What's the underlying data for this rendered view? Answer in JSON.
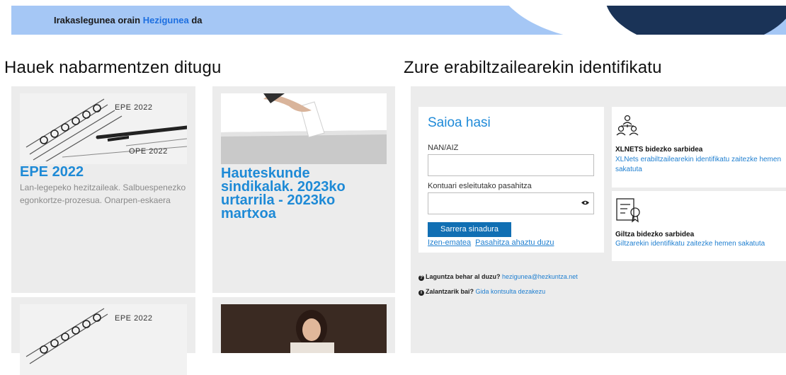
{
  "banner": {
    "prefix": "Irakaslegunea orain ",
    "highlight": "Hezigunea",
    "suffix": " da"
  },
  "highlights": {
    "title": "Hauek nabarmentzen ditugu",
    "cards": [
      {
        "img_labels": [
          "EPE 2022",
          "OPE 2022"
        ],
        "title": "EPE 2022",
        "desc": "Lan-legepeko hezitzaileak. Salbuespenezko egonkortze-prozesua. Onarpen-eskaera"
      },
      {
        "title": "Hauteskunde sindikalak. 2023ko urtarrila - 2023ko martxoa",
        "desc": ""
      },
      {
        "img_labels": [
          "EPE 2022"
        ]
      },
      {}
    ]
  },
  "login": {
    "section_title": "Zure erabiltzailearekin identifikatu",
    "box_title": "Saioa hasi",
    "user_label": "NAN/AIZ",
    "password_label": "Kontuari esleitutako pasahitza",
    "submit_label": "Sarrera sinadura",
    "register_link": "Izen-ematea",
    "forgot_link": "Pasahitza ahaztu duzu",
    "xlnets": {
      "title": "XLNETS bidezko sarbidea",
      "desc": "XLNets erabiltzailearekin identifikatu zaitezke hemen sakatuta"
    },
    "giltza": {
      "title": "Giltza bidezko sarbidea",
      "desc": "Giltzarekin identifikatu zaitezke hemen sakatuta"
    },
    "help": {
      "q1": "Laguntza behar al duzu?",
      "email": "hezigunea@hezkuntza.net",
      "q2": "Zalantzarik bai?",
      "guide": "Gida kontsulta dezakezu"
    }
  }
}
